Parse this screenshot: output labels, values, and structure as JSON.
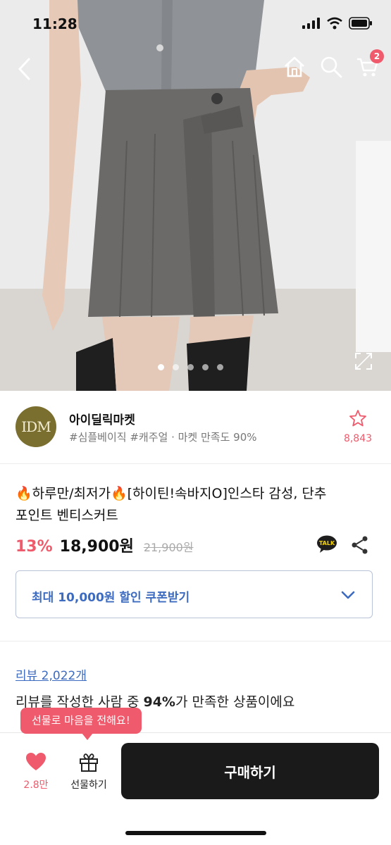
{
  "status": {
    "time": "11:28"
  },
  "nav": {
    "back": "chevron-left-icon",
    "home": "home-icon",
    "search": "search-icon",
    "cart": "cart-icon",
    "cart_badge": "2"
  },
  "gallery": {
    "slide_count": 5,
    "active_slide": 1
  },
  "store": {
    "logo_text": "IDM",
    "name": "아이딜릭마켓",
    "tags": "#심플베이직 #캐주얼 · 마켓 만족도 90%",
    "favorite_count": "8,843"
  },
  "product": {
    "title_line1": "🔥하루만/최저가🔥[하이틴!속바지O]인스타 감성, 단추",
    "title_line2": "포인트 벤티스커트",
    "discount": "13%",
    "price": "18,900원",
    "original_price": "21,900원"
  },
  "coupon": {
    "label": "최대 10,000원 할인 쿠폰받기"
  },
  "reviews": {
    "link": "리뷰 2,022개",
    "summary_prefix": "리뷰를 작성한 사람 중 ",
    "summary_percent": "94%",
    "summary_suffix": "가 만족한 상품이에요"
  },
  "bottom": {
    "gift_tooltip": "선물로 마음을 전해요!",
    "like_count": "2.8만",
    "gift_label": "선물하기",
    "buy_label": "구매하기"
  },
  "colors": {
    "accent": "#ef5b6c",
    "link": "#3d6bc0",
    "buy": "#1a1a1a"
  }
}
